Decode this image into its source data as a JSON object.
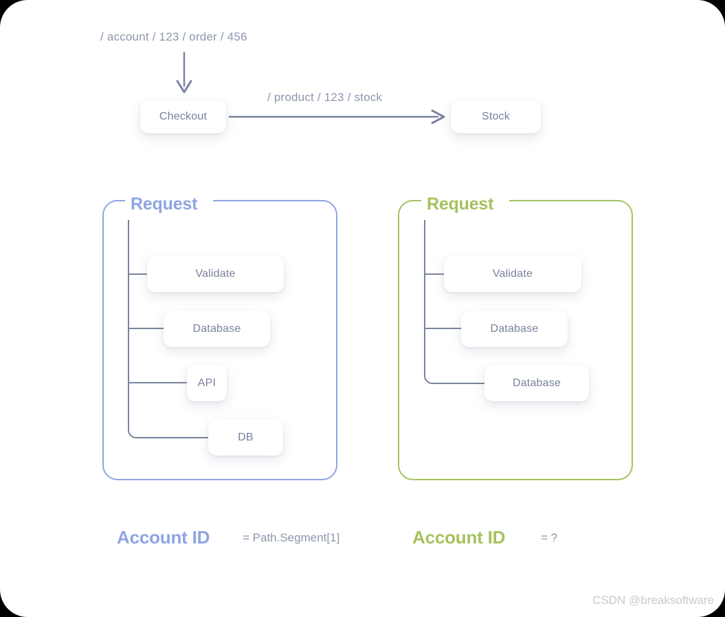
{
  "colors": {
    "blue": "#8ea4e3",
    "green": "#a4c25e",
    "line": "#78839e",
    "text": "#78819a",
    "muted": "#8d96ad",
    "watermark": "#c9c9c9"
  },
  "flow": {
    "incoming_path": "/ account / 123 / order / 456",
    "outgoing_path": "/ product / 123 / stock",
    "source_node": "Checkout",
    "target_node": "Stock",
    "down_arrow_icon": "arrow-down-icon",
    "right_arrow_icon": "arrow-right-icon"
  },
  "panels": [
    {
      "title": "Request",
      "accent": "#8ea4e3",
      "steps": [
        {
          "label": "Validate"
        },
        {
          "label": "Database"
        },
        {
          "label": "API"
        },
        {
          "label": "DB"
        }
      ]
    },
    {
      "title": "Request",
      "accent": "#a4c25e",
      "steps": [
        {
          "label": "Validate"
        },
        {
          "label": "Database"
        },
        {
          "label": "Database"
        }
      ]
    }
  ],
  "legend": [
    {
      "key": "Account ID",
      "value": "= Path.Segment[1]",
      "accent": "#8ea4e3"
    },
    {
      "key": "Account ID",
      "value": "= ?",
      "accent": "#a4c25e"
    }
  ],
  "watermark": "CSDN @breaksoftware"
}
